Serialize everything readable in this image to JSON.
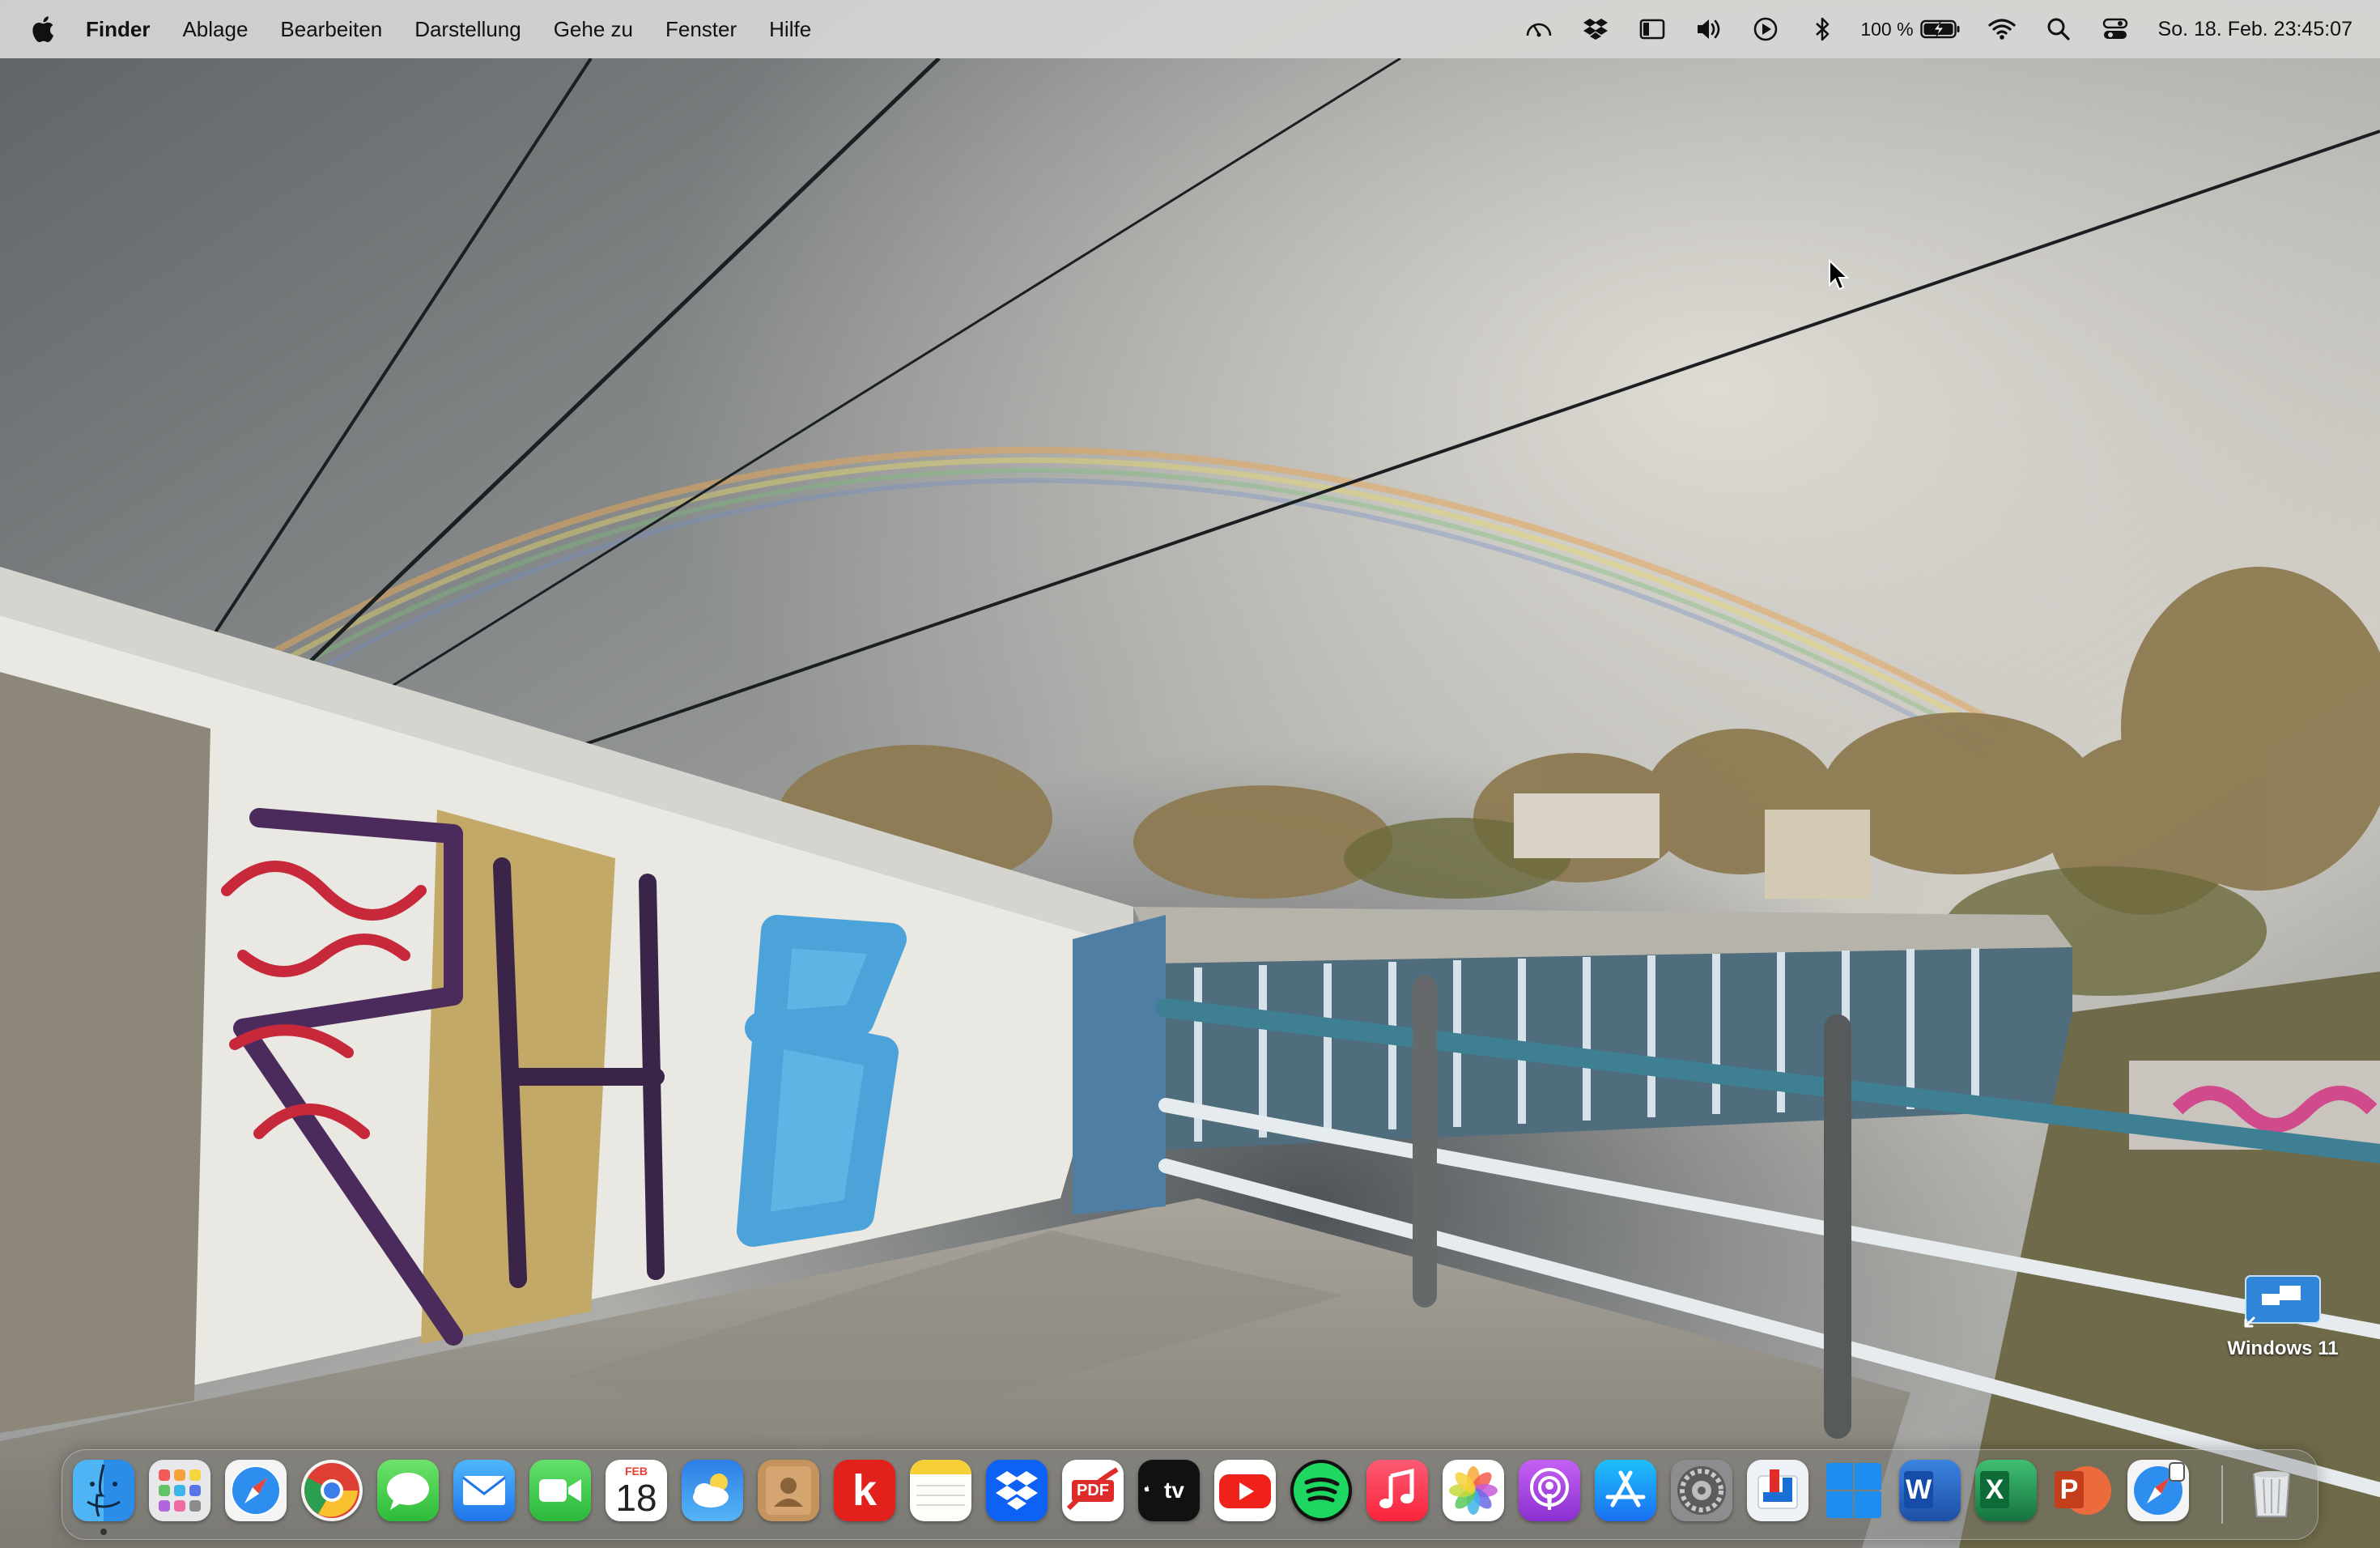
{
  "menubar": {
    "apple_icon": "apple-logo-icon",
    "app_name": "Finder",
    "menus": [
      "Ablage",
      "Bearbeiten",
      "Darstellung",
      "Gehe zu",
      "Fenster",
      "Hilfe"
    ],
    "status_icons": [
      "speedometer-icon",
      "dropbox-icon",
      "sidebar-icon",
      "volume-icon",
      "play-icon",
      "bluetooth-icon"
    ],
    "battery_percent": "100 %",
    "battery_level": 1.0,
    "right_icons": [
      "wifi-icon",
      "spotlight-search-icon",
      "control-center-icon"
    ],
    "clock": "So. 18. Feb.  23:45:07"
  },
  "desktop": {
    "icon_label": "Windows 11"
  },
  "dock": {
    "calendar_month": "FEB",
    "calendar_day": "18",
    "pdf_label": "PDF",
    "tv_label": "tv",
    "kleinanzeigen_letter": "k",
    "word_letter": "W",
    "excel_letter": "X",
    "powerpoint_letter": "P",
    "apps": [
      "finder",
      "launchpad",
      "safari",
      "chrome",
      "messages",
      "mail",
      "facetime",
      "calendar",
      "weather",
      "contacts",
      "kleinanzeigen",
      "notes",
      "dropbox",
      "pdf-expert",
      "apple-tv",
      "youtube",
      "spotify",
      "music",
      "photos",
      "podcasts",
      "app-store",
      "system-settings",
      "parallels",
      "windows",
      "word",
      "excel",
      "powerpoint",
      "safari-preview",
      "trash"
    ]
  },
  "colors": {
    "menubar_bg": "#d6d6d4",
    "sky": "#6f7478",
    "rainbow": "#e8b070"
  }
}
